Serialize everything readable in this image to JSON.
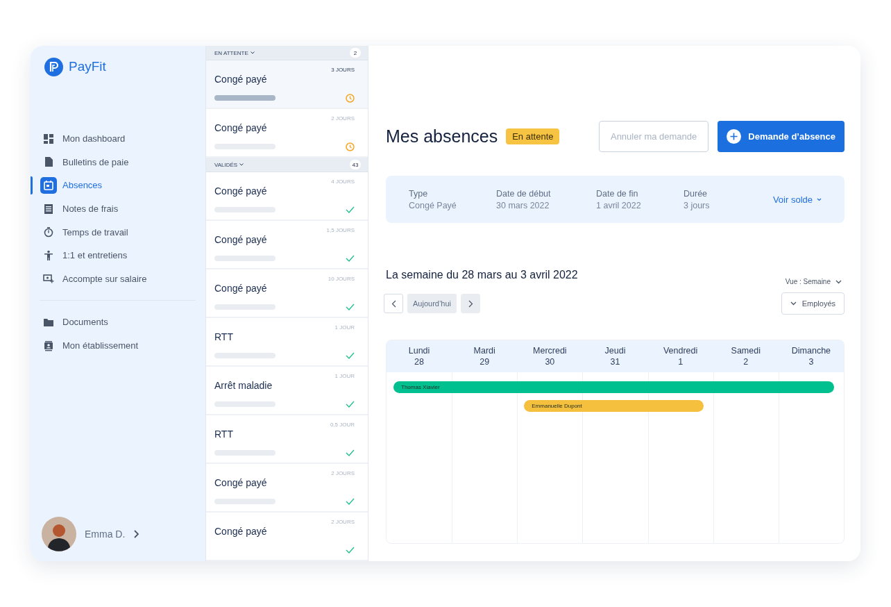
{
  "app": {
    "logo": "PayFit"
  },
  "sidebar": {
    "nav": [
      {
        "label": "Mon dashboard",
        "selected": false
      },
      {
        "label": "Bulletins de paie",
        "selected": false
      },
      {
        "label": "Absences",
        "selected": true
      },
      {
        "label": "Notes de frais",
        "selected": false
      },
      {
        "label": "Temps de travail",
        "selected": false
      },
      {
        "label": "1:1 et entretiens",
        "selected": false
      },
      {
        "label": "Accompte sur salaire",
        "selected": false
      }
    ],
    "nav_secondary": [
      {
        "label": "Documents",
        "selected": false
      },
      {
        "label": "Mon établissement",
        "selected": false
      }
    ],
    "user": {
      "name": "Emma D."
    }
  },
  "requests": {
    "groups": [
      {
        "title": "EN ATTENTE",
        "count": "2",
        "items": [
          {
            "type": "Congé payé",
            "duration": "3 JOURS",
            "approved": false,
            "selected": true,
            "bar": true
          },
          {
            "type": "Congé payé",
            "duration": "2 JOURS",
            "approved": false,
            "selected": false,
            "bar": true
          }
        ]
      },
      {
        "title": "VALIDÉS",
        "count": "43",
        "items": [
          {
            "type": "Congé payé",
            "duration": "4 JOURS",
            "approved": true,
            "selected": false,
            "bar": true
          },
          {
            "type": "Congé payé",
            "duration": "1,5 JOURS",
            "approved": true,
            "selected": false,
            "bar": true
          },
          {
            "type": "Congé payé",
            "duration": "10 JOURS",
            "approved": true,
            "selected": false,
            "bar": true
          },
          {
            "type": "RTT",
            "duration": "1 JOUR",
            "approved": true,
            "selected": false,
            "bar": true
          },
          {
            "type": "Arrêt maladie",
            "duration": "1 JOUR",
            "approved": true,
            "selected": false,
            "bar": true
          },
          {
            "type": "RTT",
            "duration": "0,5 JOUR",
            "approved": true,
            "selected": false,
            "bar": true
          },
          {
            "type": "Congé payé",
            "duration": "2 JOURS",
            "approved": true,
            "selected": false,
            "bar": true
          },
          {
            "type": "Congé payé",
            "duration": "2 JOURS",
            "approved": true,
            "selected": false,
            "bar": false
          }
        ]
      }
    ]
  },
  "main": {
    "title": "Mes absences",
    "badge": "En attente",
    "buttons": [
      {
        "label": "Annuler ma demande",
        "kind": "secondary"
      },
      {
        "label": "Demande d’absence",
        "kind": "primary"
      }
    ],
    "summary": [
      {
        "label": "Type",
        "value": "Congé Payé"
      },
      {
        "label": "Date de début",
        "value": "30 mars 2022"
      },
      {
        "label": "Date de fin",
        "value": "1 avril 2022"
      },
      {
        "label": "Durée",
        "value": "3 jours"
      }
    ],
    "summary_link": "Voir solde",
    "week_title": "La semaine du 28 mars au 3 avril 2022",
    "view_selector": "Vue : Semaine",
    "today_button": "Aujourd’hui",
    "filter_button": "Employés",
    "calendar": {
      "days": [
        {
          "name": "Lundi",
          "date": "28"
        },
        {
          "name": "Mardi",
          "date": "29"
        },
        {
          "name": "Mercredi",
          "date": "30"
        },
        {
          "name": "Jeudi",
          "date": "31"
        },
        {
          "name": "Vendredi",
          "date": "1"
        },
        {
          "name": "Samedi",
          "date": "2"
        },
        {
          "name": "Dimanche",
          "date": "3"
        }
      ],
      "events": [
        {
          "name": "Thomas Xiavier",
          "color": "#00c08f",
          "days": [
            true,
            true,
            true,
            true,
            true,
            true,
            true
          ]
        },
        {
          "name": "Emmanuelle Dupont",
          "color": "#f5c03e",
          "days": [
            false,
            false,
            true,
            true,
            true,
            false,
            false
          ]
        }
      ]
    }
  }
}
